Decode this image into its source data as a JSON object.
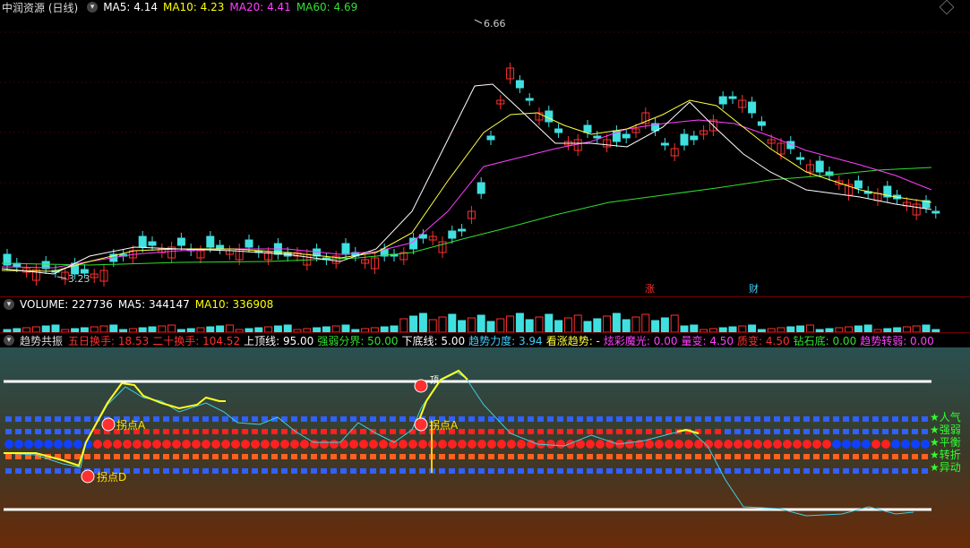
{
  "main_header": {
    "title": "中润资源 (日线)",
    "ma5": "MA5: 4.14",
    "ma10": "MA10: 4.23",
    "ma20": "MA20: 4.41",
    "ma60": "MA60: 4.69"
  },
  "main_chart": {
    "high_label": "6.66",
    "low_label": "3.23",
    "event_labels": [
      "涨",
      "财"
    ]
  },
  "volume_header": {
    "title": "VOLUME: 227736",
    "ma5": "MA5: 344147",
    "ma10": "MA10: 336908"
  },
  "indicator_header": {
    "title": "趋势共振",
    "items": [
      {
        "label": "五日换手:",
        "value": "18.53",
        "color": "#ff3030"
      },
      {
        "label": "二十换手:",
        "value": "104.52",
        "color": "#ff3030"
      },
      {
        "label": "上顶线:",
        "value": "95.00",
        "color": "#ffffff"
      },
      {
        "label": "强弱分界:",
        "value": "50.00",
        "color": "#30e030"
      },
      {
        "label": "下底线:",
        "value": "5.00",
        "color": "#ffffff"
      },
      {
        "label": "趋势力度:",
        "value": "3.94",
        "color": "#40d0ff"
      },
      {
        "label": "看涨趋势:",
        "value": "-",
        "color": "#ffff40"
      },
      {
        "label": "炫彩魔光:",
        "value": "0.00",
        "color": "#ff40ff"
      },
      {
        "label": "量变:",
        "value": "4.50",
        "color": "#ff40ff"
      },
      {
        "label": "质变:",
        "value": "4.50",
        "color": "#ff3030"
      },
      {
        "label": "钻石底:",
        "value": "0.00",
        "color": "#30e030"
      },
      {
        "label": "趋势转弱:",
        "value": "0.00",
        "color": "#ff40ff"
      }
    ]
  },
  "indicator_labels": {
    "turn_a1": "拐点A",
    "turn_a2": "拐点A",
    "turn_d": "拐点D",
    "top": "顶",
    "right_legend": [
      "人气",
      "强弱",
      "平衡",
      "转折",
      "异动"
    ]
  },
  "colors": {
    "ma5": "#ffffff",
    "ma10": "#ffff00",
    "ma20": "#ff40ff",
    "ma60": "#30e030",
    "up": "#ff3030",
    "down": "#40e0e0"
  }
}
